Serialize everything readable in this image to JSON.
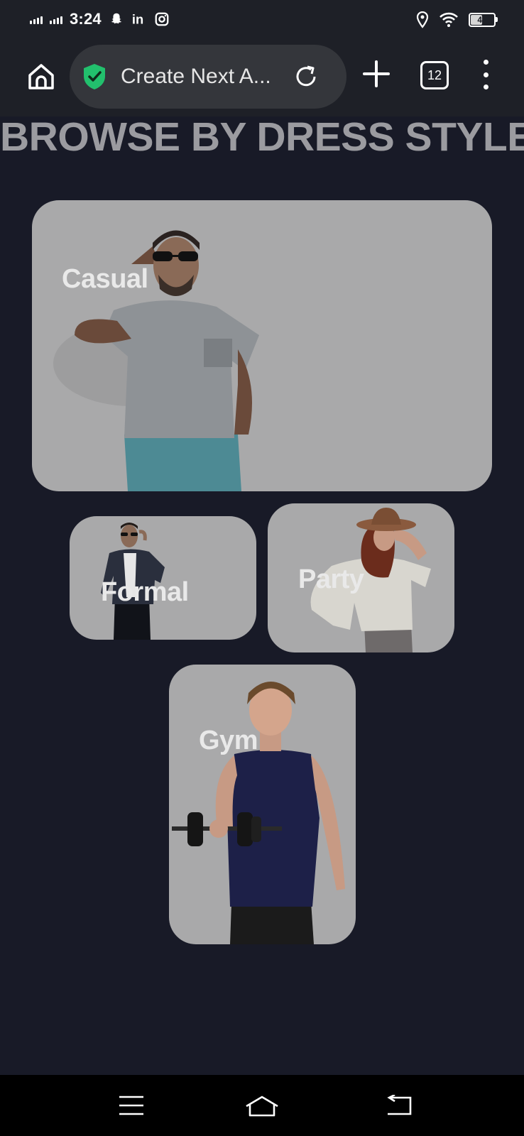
{
  "status_bar": {
    "time": "3:24",
    "battery": "47"
  },
  "browser": {
    "url_title": "Create Next A...",
    "tab_count": "12"
  },
  "page": {
    "title": "BROWSE BY DRESS STYLE",
    "categories": [
      {
        "label": "Casual"
      },
      {
        "label": "Formal"
      },
      {
        "label": "Party"
      },
      {
        "label": "Gym"
      }
    ]
  },
  "colors": {
    "background": "#181a27",
    "card": "#a9a9aa",
    "shield": "#22c06d"
  }
}
